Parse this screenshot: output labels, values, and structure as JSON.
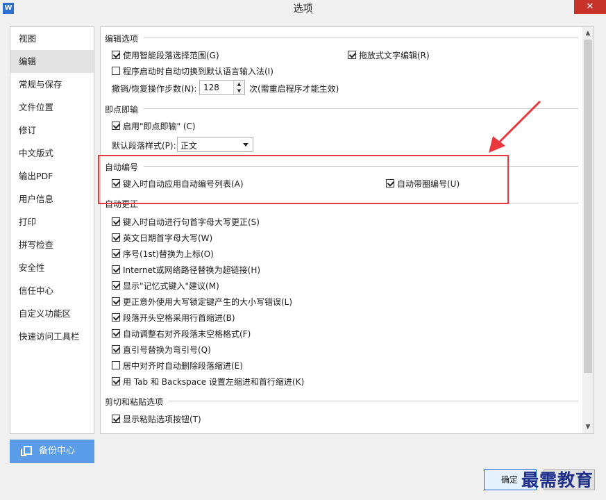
{
  "window": {
    "title": "选项",
    "app_icon": "W",
    "close_glyph": "✕"
  },
  "sidebar": {
    "items": [
      {
        "label": "视图"
      },
      {
        "label": "编辑"
      },
      {
        "label": "常规与保存"
      },
      {
        "label": "文件位置"
      },
      {
        "label": "修订"
      },
      {
        "label": "中文版式"
      },
      {
        "label": "输出PDF"
      },
      {
        "label": "用户信息"
      },
      {
        "label": "打印"
      },
      {
        "label": "拼写检查"
      },
      {
        "label": "安全性"
      },
      {
        "label": "信任中心"
      },
      {
        "label": "自定义功能区"
      },
      {
        "label": "快速访问工具栏"
      }
    ],
    "active": "编辑"
  },
  "backup": {
    "label": "备份中心",
    "icon": "copy-icon"
  },
  "editing_options": {
    "title": "编辑选项",
    "smart_paragraph": {
      "label": "使用智能段落选择范围(G)",
      "checked": true
    },
    "drag_text": {
      "label": "拖放式文字编辑(R)",
      "checked": true
    },
    "auto_ime": {
      "label": "程序启动时自动切换到默认语言输入法(I)",
      "checked": false
    },
    "undo_steps_label": "撤销/恢复操作步数(N):",
    "undo_steps_value": "128",
    "undo_steps_note": "次(需重启程序才能生效)"
  },
  "click_type": {
    "title": "即点即输",
    "enable": {
      "label": "启用\"即点即输\" (C)",
      "checked": true
    },
    "default_style_label": "默认段落样式(P):",
    "default_style_value": "正文"
  },
  "auto_number": {
    "title": "自动编号",
    "apply_list": {
      "label": "键入时自动应用自动编号列表(A)",
      "checked": true
    },
    "circle_number": {
      "label": "自动带圈编号(U)",
      "checked": true
    }
  },
  "auto_correct": {
    "title": "自动更正",
    "items": [
      {
        "label": "键入时自动进行句首字母大写更正(S)",
        "checked": true
      },
      {
        "label": "英文日期首字母大写(W)",
        "checked": true
      },
      {
        "label": "序号(1st)替换为上标(O)",
        "checked": true
      },
      {
        "label": "Internet或网络路径替换为超链接(H)",
        "checked": true
      },
      {
        "label": "显示\"记忆式键入\"建议(M)",
        "checked": true
      },
      {
        "label": "更正意外使用大写锁定键产生的大小写错误(L)",
        "checked": true
      },
      {
        "label": "段落开头空格采用行首缩进(B)",
        "checked": true
      },
      {
        "label": "自动调整右对齐段落末空格格式(F)",
        "checked": true
      },
      {
        "label": "直引号替换为弯引号(Q)",
        "checked": true
      },
      {
        "label": "居中对齐时自动删除段落缩进(E)",
        "checked": false
      },
      {
        "label": "用 Tab 和 Backspace 设置左缩进和首行缩进(K)",
        "checked": true
      }
    ]
  },
  "cut_paste": {
    "title": "剪切和粘贴选项",
    "show_paste_btn": {
      "label": "显示粘贴选项按钮(T)",
      "checked": true
    }
  },
  "buttons": {
    "ok": "确定"
  },
  "watermark": "最需教育",
  "colors": {
    "highlight_box": "#e8383d",
    "backup_btn": "#5b9ce8",
    "watermark": "#1f2f8a"
  }
}
